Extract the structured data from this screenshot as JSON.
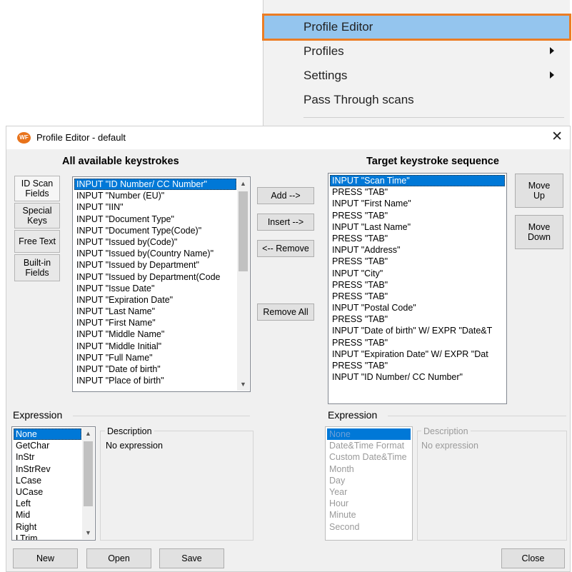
{
  "context_menu": {
    "items": [
      {
        "label": "Profile Editor",
        "highlighted": true,
        "submenu": false
      },
      {
        "label": "Profiles",
        "submenu": true
      },
      {
        "label": "Settings",
        "submenu": true
      },
      {
        "label": "Pass Through scans",
        "submenu": false
      }
    ],
    "highlight_color": "#94c5ee",
    "outline_color": "#ec7d24"
  },
  "dialog": {
    "title": "Profile Editor - default",
    "logo_text": "WF",
    "close_glyph": "✕",
    "left_header": "All available keystrokes",
    "right_header": "Target keystroke sequence",
    "side_tabs": [
      {
        "line1": "ID Scan",
        "line2": "Fields"
      },
      {
        "line1": "Special",
        "line2": "Keys"
      },
      {
        "line1": "Free Text",
        "line2": ""
      },
      {
        "line1": "Built-in",
        "line2": "Fields"
      }
    ],
    "available_keystrokes": [
      "INPUT \"ID Number/ CC Number\"",
      "INPUT \"Number (EU)\"",
      "INPUT \"IIN\"",
      "INPUT \"Document Type\"",
      "INPUT \"Document Type(Code)\"",
      "INPUT \"Issued by(Code)\"",
      "INPUT \"Issued by(Country Name)\"",
      "INPUT \"Issued by Department\"",
      "INPUT \"Issued by Department(Code",
      "INPUT \"Issue Date\"",
      "INPUT \"Expiration Date\"",
      "INPUT \"Last Name\"",
      "INPUT \"First Name\"",
      "INPUT \"Middle Name\"",
      "INPUT \"Middle Initial\"",
      "INPUT \"Full Name\"",
      "INPUT \"Date of birth\"",
      "INPUT \"Place of birth\""
    ],
    "middle_buttons": {
      "add": "Add -->",
      "insert": "Insert -->",
      "remove": "<-- Remove",
      "remove_all": "Remove All"
    },
    "target_sequence": [
      "INPUT \"Scan Time\"",
      "PRESS \"TAB\"",
      "INPUT \"First Name\"",
      "PRESS \"TAB\"",
      "INPUT \"Last Name\"",
      "PRESS \"TAB\"",
      "INPUT \"Address\"",
      "PRESS \"TAB\"",
      "INPUT \"City\"",
      "PRESS \"TAB\"",
      "PRESS \"TAB\"",
      "INPUT \"Postal Code\"",
      "PRESS \"TAB\"",
      "INPUT \"Date of birth\" W/ EXPR \"Date&T",
      "PRESS \"TAB\"",
      "INPUT \"Expiration Date\" W/ EXPR \"Dat",
      "PRESS \"TAB\"",
      "INPUT \"ID Number/ CC Number\""
    ],
    "move_up": {
      "line1": "Move",
      "line2": "Up"
    },
    "move_down": {
      "line1": "Move",
      "line2": "Down"
    },
    "left_expression": {
      "title": "Expression",
      "items": [
        "None",
        "GetChar",
        "InStr",
        "InStrRev",
        "LCase",
        "UCase",
        "Left",
        "Mid",
        "Right",
        "LTrim"
      ],
      "description_label": "Description",
      "description_text": "No expression"
    },
    "right_expression": {
      "title": "Expression",
      "items": [
        "None",
        "Date&Time Format",
        "Custom Date&Time",
        "Month",
        "Day",
        "Year",
        "Hour",
        "Minute",
        "Second"
      ],
      "description_label": "Description",
      "description_text": "No expression"
    },
    "footer": {
      "new": "New",
      "open": "Open",
      "save": "Save",
      "close": "Close"
    },
    "selection_color": "#0078d7"
  }
}
